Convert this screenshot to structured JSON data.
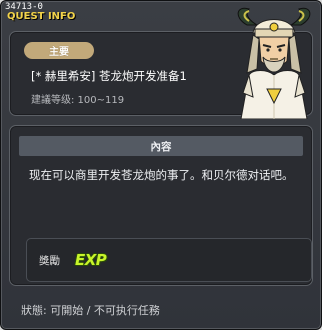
{
  "window": {
    "quest_id": "34713-0",
    "title": "QUEST INFO"
  },
  "quest": {
    "tag": "主要",
    "name": "[* 赫里希安] 苍龙炮开发准备1",
    "level_range": "建議等级: 100~119"
  },
  "content": {
    "header": "內容",
    "text": "现在可以商里开发苍龙炮的事了。和贝尔德对话吧。"
  },
  "reward": {
    "label": "獎勵",
    "exp_label": "EXP"
  },
  "status": {
    "text": "狀態: 可開始 / 不可执行任務"
  },
  "colors": {
    "title": "#f2d34a",
    "tag_bg": "#c2a97a",
    "exp": "#c8f52a",
    "panel_bg": "#2a2c31",
    "window_bg": "#34373d"
  },
  "icons": {
    "npc": "npc-portrait-icon",
    "exp": "exp-icon"
  }
}
